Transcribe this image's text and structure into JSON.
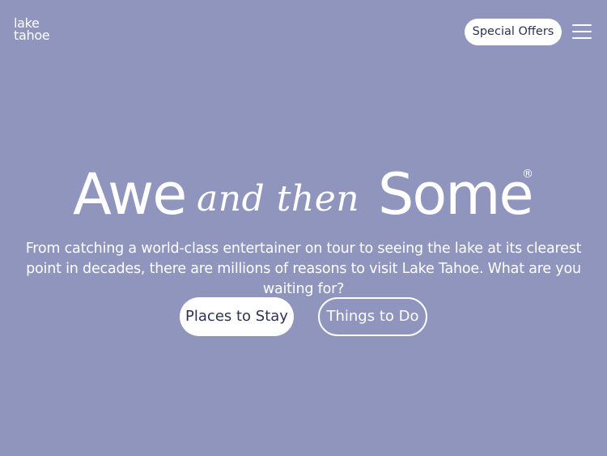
{
  "header": {
    "logo_line1": "lake",
    "logo_line2": "tahoe",
    "offers_label": "Special Offers",
    "menu_icon": "hamburger-menu-icon"
  },
  "hero": {
    "headline_part1": "Awe",
    "headline_script": "and then",
    "headline_part2": "Some",
    "registered_mark": "®",
    "intro": "From catching a world-class entertainer on tour to seeing the lake at its clearest point in decades, there are millions of reasons to visit Lake Tahoe. What are you waiting for?",
    "primary_button": "Places to Stay",
    "secondary_button": "Things to Do"
  },
  "colors": {
    "background": "#8f95bd",
    "text": "#ffffff",
    "button_text": "#2b3256"
  }
}
